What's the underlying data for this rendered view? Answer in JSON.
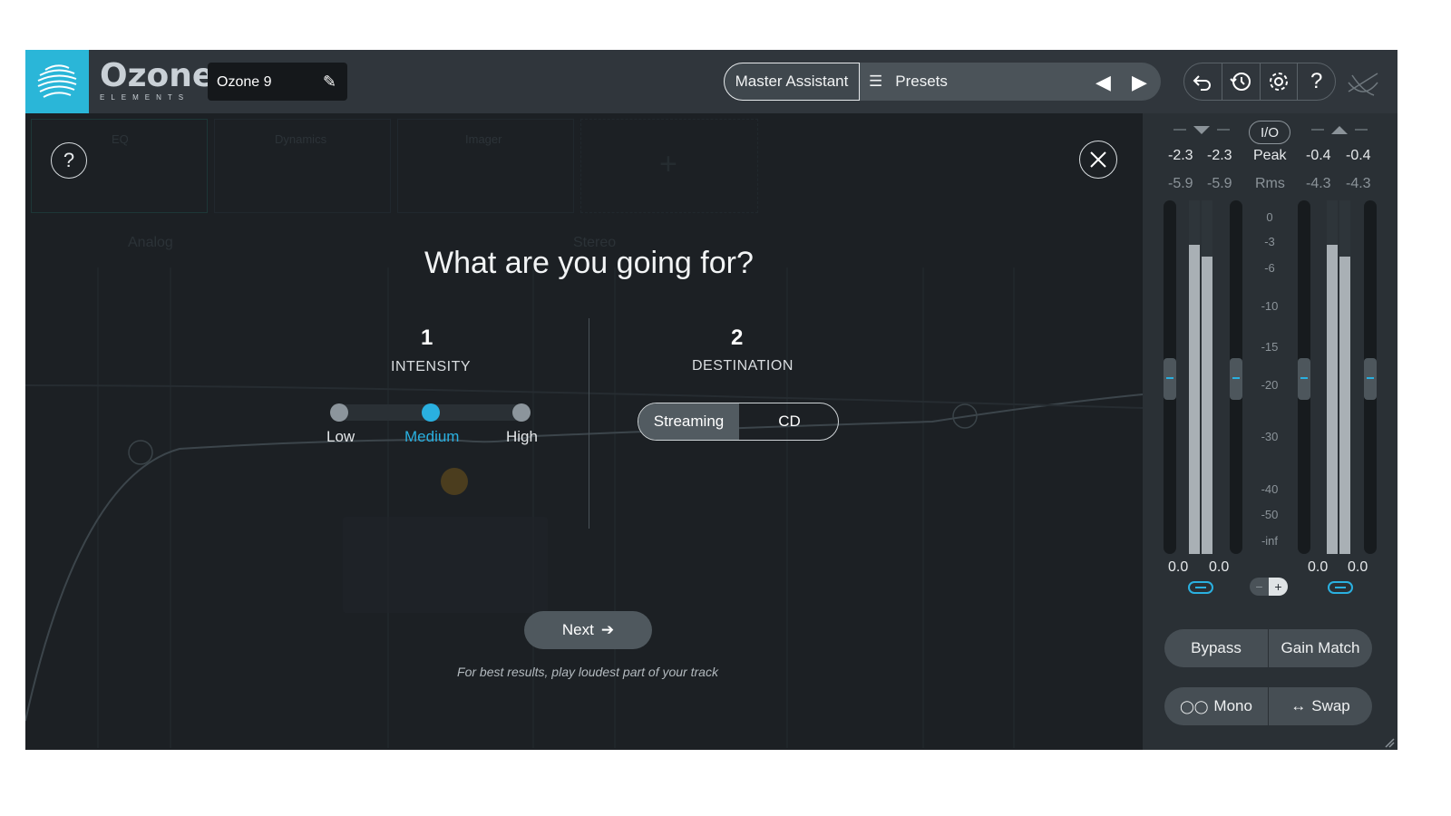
{
  "header": {
    "brand_name": "Ozone",
    "brand_sub": "ELEMENTS",
    "preset_name": "Ozone 9",
    "master_assistant_label": "Master Assistant",
    "presets_label": "Presets"
  },
  "modules": [
    {
      "label": "EQ"
    },
    {
      "label": "Dynamics"
    },
    {
      "label": "Imager"
    }
  ],
  "graph": {
    "mode_label": "Analog",
    "stereo_label": "Stereo"
  },
  "dialog": {
    "question": "What are you going for?",
    "step1": {
      "number": "1",
      "label": "INTENSITY"
    },
    "step2": {
      "number": "2",
      "label": "DESTINATION"
    },
    "intensity_options": [
      "Low",
      "Medium",
      "High"
    ],
    "intensity_selected": "Medium",
    "destination_options": [
      "Streaming",
      "CD"
    ],
    "destination_selected": "Streaming",
    "next_label": "Next",
    "hint": "For best results, play loudest part of your track"
  },
  "meters": {
    "io_label": "I/O",
    "peak_label": "Peak",
    "rms_label": "Rms",
    "input_peak": [
      "-2.3",
      "-2.3"
    ],
    "input_rms": [
      "-5.9",
      "-5.9"
    ],
    "output_peak": [
      "-0.4",
      "-0.4"
    ],
    "output_rms": [
      "-4.3",
      "-4.3"
    ],
    "scale": [
      "0",
      "-3",
      "-6",
      "-10",
      "-15",
      "-20",
      "-30",
      "-40",
      "-50",
      "-inf"
    ],
    "input_gain": [
      "0.0",
      "0.0"
    ],
    "output_gain": [
      "0.0",
      "0.0"
    ],
    "bypass_label": "Bypass",
    "gain_match_label": "Gain Match",
    "mono_label": "Mono",
    "swap_label": "Swap"
  },
  "colors": {
    "accent": "#2ab0e0",
    "logo_bg": "#2ab6d8",
    "background": "#1c2024"
  }
}
